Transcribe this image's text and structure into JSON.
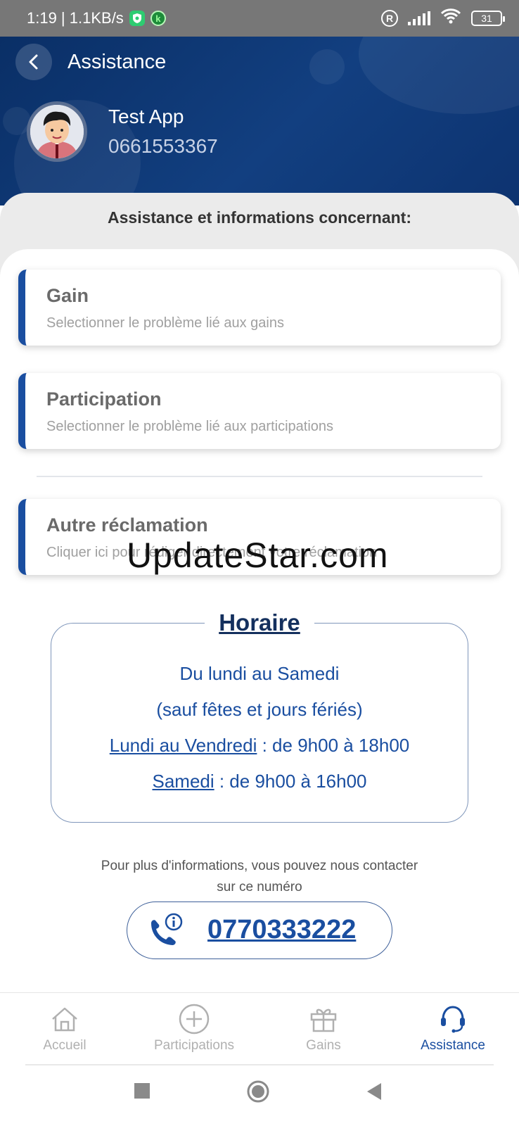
{
  "status_bar": {
    "time_speed": "1:19 | 1.1KB/s",
    "k_badge": "k",
    "battery": "31"
  },
  "header": {
    "title": "Assistance",
    "user_name": "Test App",
    "user_phone": "0661553367"
  },
  "section": {
    "title": "Assistance et informations concernant:"
  },
  "options": [
    {
      "title": "Gain",
      "subtitle": "Selectionner le problème lié aux gains"
    },
    {
      "title": "Participation",
      "subtitle": "Selectionner le problème lié aux participations"
    },
    {
      "title": "Autre réclamation",
      "subtitle": "Cliquer ici pour rédiger directement votre réclamation"
    }
  ],
  "watermark": "UpdateStar.com",
  "hours": {
    "title": "Horaire",
    "line1": "Du lundi au Samedi",
    "line2": "(sauf fêtes et jours fériés)",
    "weekday_label": "Lundi au Vendredi",
    "weekday_hours": " : de 9h00 à 18h00",
    "saturday_label": "Samedi",
    "saturday_hours": " : de 9h00 à 16h00"
  },
  "contact": {
    "line1": "Pour plus d'informations, vous pouvez nous contacter",
    "line2": "sur ce numéro",
    "phone": "0770333222"
  },
  "bottom_nav": [
    {
      "label": "Accueil",
      "icon": "home-icon",
      "active": false
    },
    {
      "label": "Participations",
      "icon": "plus-circle-icon",
      "active": false
    },
    {
      "label": "Gains",
      "icon": "gift-icon",
      "active": false
    },
    {
      "label": "Assistance",
      "icon": "headset-icon",
      "active": true
    }
  ],
  "colors": {
    "primary": "#1a4ea0",
    "header_dark": "#0a2f66",
    "inactive": "#b0b0b0"
  }
}
